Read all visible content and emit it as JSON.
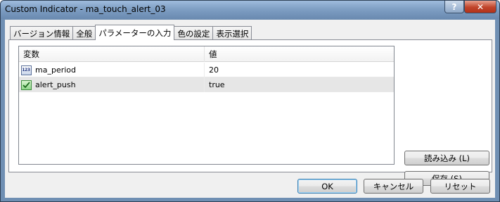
{
  "window": {
    "title": "Custom Indicator - ma_touch_alert_03",
    "help_label": "?",
    "close_label": "✕"
  },
  "tabs": [
    {
      "label": "バージョン情報",
      "active": false
    },
    {
      "label": "全般",
      "active": false
    },
    {
      "label": "パラメーターの入力",
      "active": true
    },
    {
      "label": "色の設定",
      "active": false
    },
    {
      "label": "表示選択",
      "active": false
    }
  ],
  "grid": {
    "headers": {
      "variable": "変数",
      "value": "値"
    },
    "rows": [
      {
        "icon": "numeric-type-icon",
        "icon_text": "123",
        "name": "ma_period",
        "value": "20"
      },
      {
        "icon": "boolean-type-icon",
        "name": "alert_push",
        "value": "true"
      }
    ]
  },
  "buttons": {
    "load": "読み込み (L)",
    "save": "保存 (S)",
    "ok": "OK",
    "cancel": "キャンセル",
    "reset": "リセット"
  }
}
